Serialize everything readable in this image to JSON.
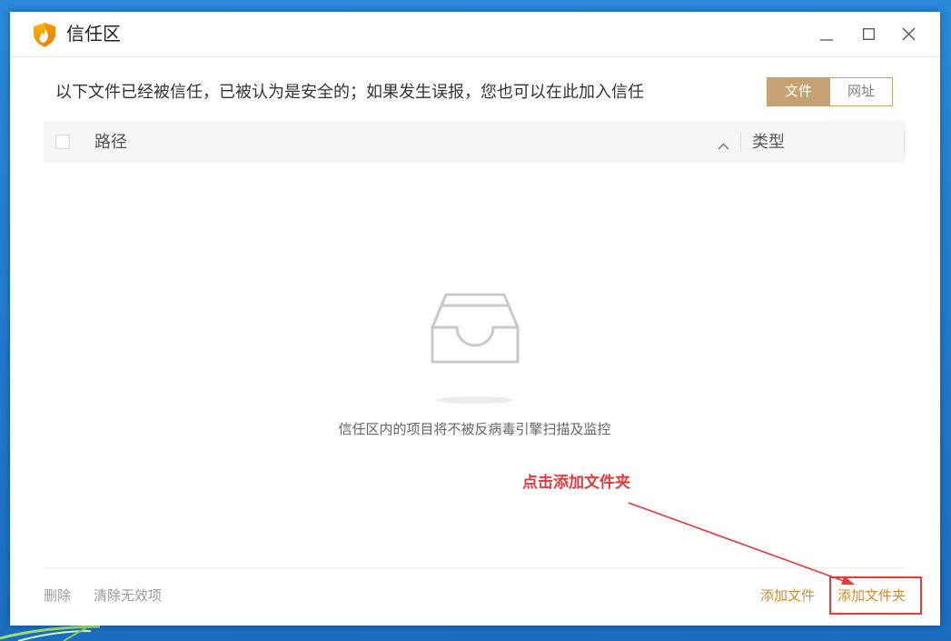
{
  "window": {
    "title": "信任区",
    "app_icon": "shield-flame-icon",
    "controls": {
      "minimize": "minimize-icon",
      "maximize": "maximize-icon",
      "close": "close-icon"
    }
  },
  "description": "以下文件已经被信任，已被认为是安全的；如果发生误报，您也可以在此加入信任",
  "toggle": {
    "options": [
      {
        "label": "文件",
        "selected": true
      },
      {
        "label": "网址",
        "selected": false
      }
    ]
  },
  "table": {
    "columns": [
      {
        "label": "路径",
        "sort_icon": "chevron-up-icon"
      },
      {
        "label": "类型"
      }
    ],
    "rows": []
  },
  "empty_state": {
    "icon": "inbox-icon",
    "message": "信任区内的项目将不被反病毒引擎扫描及监控"
  },
  "annotation": {
    "text": "点击添加文件夹"
  },
  "footer": {
    "left_actions": [
      "删除",
      "清除无效项"
    ],
    "right_actions": [
      "添加文件",
      "添加文件夹"
    ]
  },
  "colors": {
    "accent": "#c6a273",
    "action": "#d08a2c",
    "muted": "#9a9a9a",
    "annotation": "#e23b3b"
  }
}
